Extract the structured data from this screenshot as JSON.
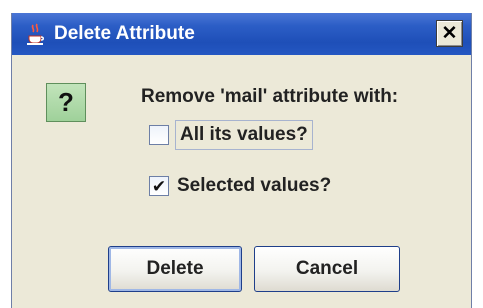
{
  "window": {
    "title": "Delete Attribute",
    "close_glyph": "✕",
    "app_icon": "java-cup-icon"
  },
  "dialog": {
    "icon": "question-icon",
    "icon_glyph": "?",
    "prompt": "Remove 'mail' attribute with:",
    "options": [
      {
        "label": "All its values?",
        "checked": false
      },
      {
        "label": "Selected values?",
        "checked": true
      }
    ],
    "check_glyph": "✔"
  },
  "buttons": {
    "delete_label": "Delete",
    "cancel_label": "Cancel"
  },
  "colors": {
    "titlebar": "#2457c2",
    "window_bg": "#ece9d8",
    "question_bg": "#a9d8a3"
  }
}
